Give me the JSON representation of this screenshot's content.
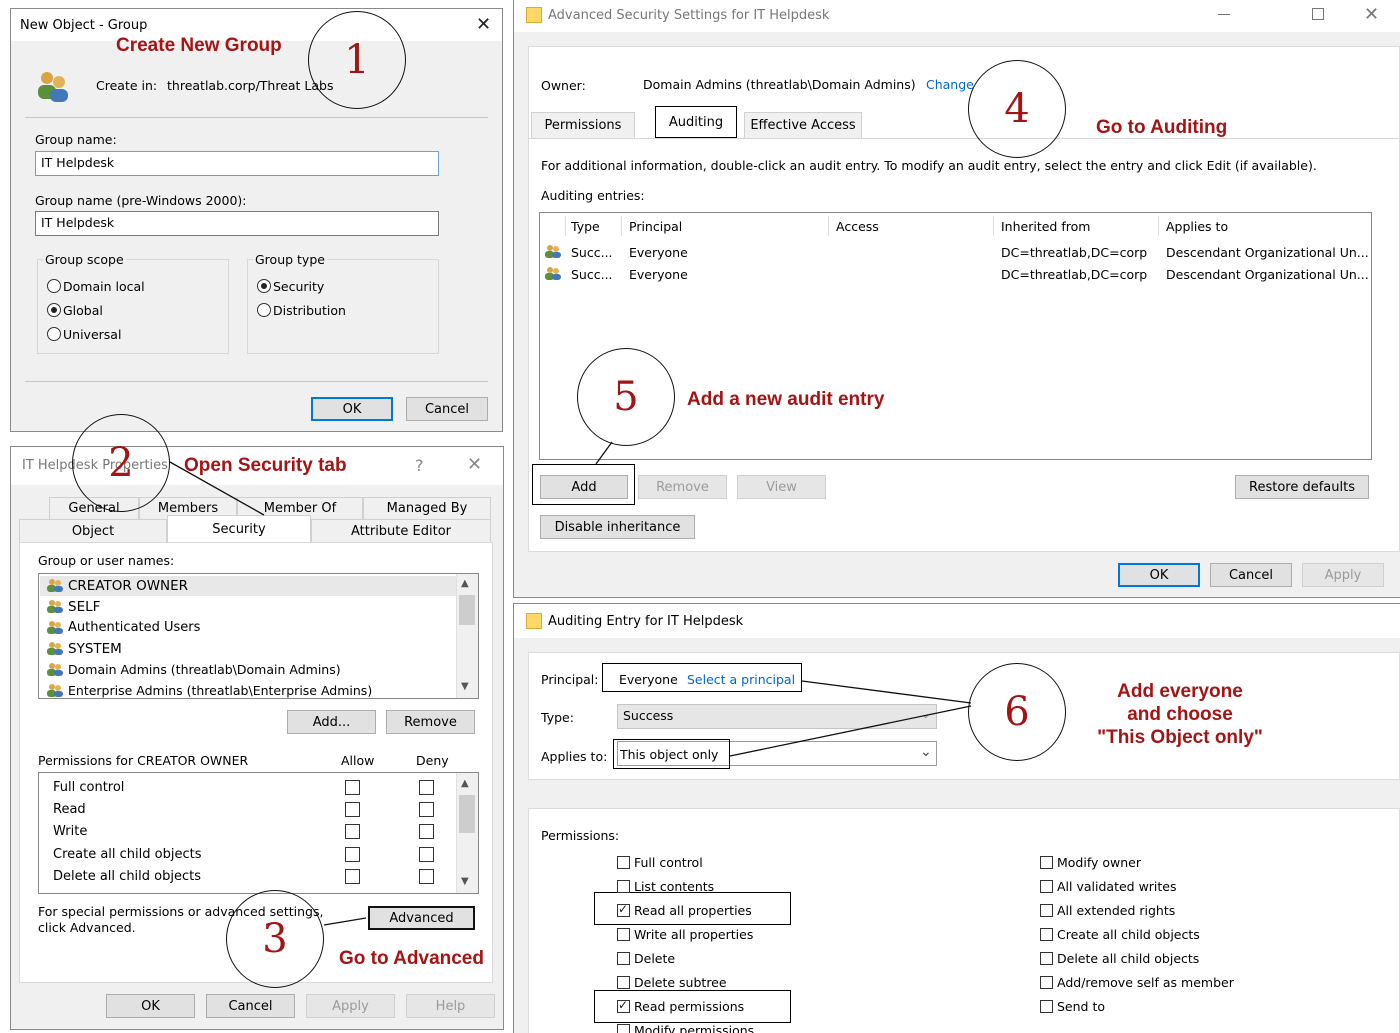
{
  "new_group": {
    "title": "New Object - Group",
    "create_in_label": "Create in:",
    "create_in_path": "threatlab.corp/Threat Labs",
    "group_name_label": "Group name:",
    "group_name_value": "IT Helpdesk",
    "pre2000_label": "Group name (pre-Windows 2000):",
    "pre2000_value": "IT Helpdesk",
    "scope_label": "Group scope",
    "scope_options": [
      "Domain local",
      "Global",
      "Universal"
    ],
    "type_label": "Group type",
    "type_options": [
      "Security",
      "Distribution"
    ],
    "ok": "OK",
    "cancel": "Cancel"
  },
  "properties": {
    "title": "IT Helpdesk Properties",
    "help_glyph": "?",
    "tabs_row1": [
      "General",
      "Members",
      "Member Of",
      "Managed By"
    ],
    "tabs_row2": [
      "Object",
      "Security",
      "Attribute Editor"
    ],
    "group_users_label": "Group or user names:",
    "users": [
      "CREATOR OWNER",
      "SELF",
      "Authenticated Users",
      "SYSTEM",
      "Domain Admins (threatlab\\Domain Admins)",
      "Enterprise Admins (threatlab\\Enterprise Admins)"
    ],
    "add": "Add...",
    "remove": "Remove",
    "perms_label": "Permissions for CREATOR OWNER",
    "allow": "Allow",
    "deny": "Deny",
    "perms": [
      "Full control",
      "Read",
      "Write",
      "Create all child objects",
      "Delete all child objects"
    ],
    "special_text": "For special permissions or advanced settings, click Advanced.",
    "advanced": "Advanced",
    "ok": "OK",
    "cancel": "Cancel",
    "apply": "Apply",
    "help": "Help"
  },
  "advanced_security": {
    "title": "Advanced Security Settings for IT Helpdesk",
    "owner_label": "Owner:",
    "owner_value": "Domain Admins (threatlab\\Domain Admins)",
    "change_link": "Change",
    "tabs": [
      "Permissions",
      "Auditing",
      "Effective Access"
    ],
    "info": "For additional information, double-click an audit entry. To modify an audit entry, select the entry and click Edit (if available).",
    "entries_label": "Auditing entries:",
    "columns": [
      "Type",
      "Principal",
      "Access",
      "Inherited from",
      "Applies to"
    ],
    "rows": [
      [
        "Succ...",
        "Everyone",
        "",
        "DC=threatlab,DC=corp",
        "Descendant Organizational Un..."
      ],
      [
        "Succ...",
        "Everyone",
        "",
        "DC=threatlab,DC=corp",
        "Descendant Organizational Un..."
      ]
    ],
    "add": "Add",
    "remove": "Remove",
    "view": "View",
    "restore": "Restore defaults",
    "disable_inheritance": "Disable inheritance",
    "ok": "OK",
    "cancel": "Cancel",
    "apply": "Apply"
  },
  "audit_entry": {
    "title": "Auditing Entry for IT Helpdesk",
    "principal_label": "Principal:",
    "principal_value": "Everyone",
    "select_principal": "Select a principal",
    "type_label": "Type:",
    "type_value": "Success",
    "applies_label": "Applies to:",
    "applies_value": "This object only",
    "permissions_label": "Permissions:",
    "left_perms": [
      {
        "label": "Full control",
        "checked": false
      },
      {
        "label": "List contents",
        "checked": false
      },
      {
        "label": "Read all properties",
        "checked": true
      },
      {
        "label": "Write all properties",
        "checked": false
      },
      {
        "label": "Delete",
        "checked": false
      },
      {
        "label": "Delete subtree",
        "checked": false
      },
      {
        "label": "Read permissions",
        "checked": true
      },
      {
        "label": "Modify permissions",
        "checked": false
      }
    ],
    "right_perms": [
      {
        "label": "Modify owner",
        "checked": false
      },
      {
        "label": "All validated writes",
        "checked": false
      },
      {
        "label": "All extended rights",
        "checked": false
      },
      {
        "label": "Create all child objects",
        "checked": false
      },
      {
        "label": "Delete all child objects",
        "checked": false
      },
      {
        "label": "Add/remove self as member",
        "checked": false
      },
      {
        "label": "Send to",
        "checked": false
      }
    ]
  },
  "annotations": {
    "step1_num": "1",
    "step1_text": "Create New Group",
    "step2_num": "2",
    "step2_text": "Open Security tab",
    "step3_num": "3",
    "step3_text": "Go to Advanced",
    "step4_num": "4",
    "step4_text": "Go to Auditing",
    "step5_num": "5",
    "step5_text": "Add a new audit entry",
    "step6_num": "6",
    "step6_line1": "Add everyone",
    "step6_line2": "and choose",
    "step6_line3": "\"This Object only\"",
    "color": "#a31515"
  }
}
